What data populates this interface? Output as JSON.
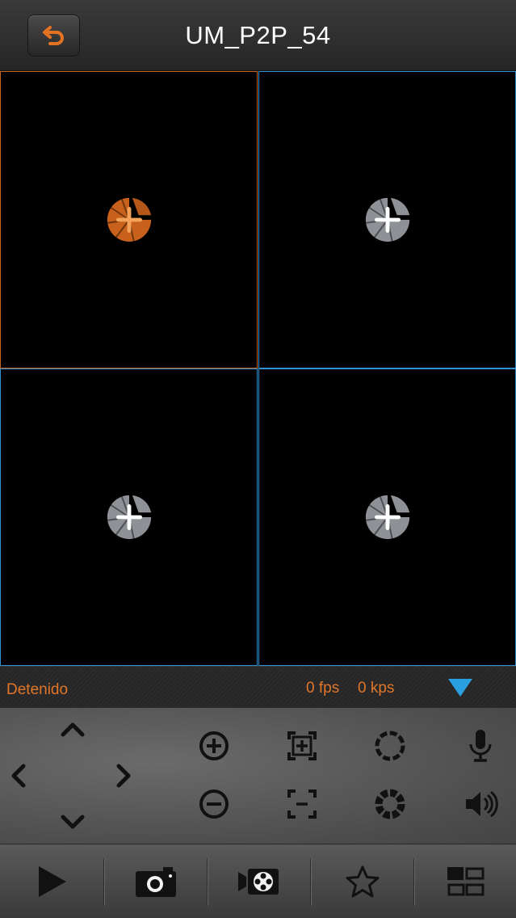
{
  "header": {
    "title": "UM_P2P_54",
    "back_icon": "back-arrow-icon",
    "accent_color": "#e37322"
  },
  "grid": {
    "cells": [
      {
        "id": "channel-1",
        "active": true,
        "icon": "add-camera-icon"
      },
      {
        "id": "channel-2",
        "active": false,
        "icon": "add-camera-icon"
      },
      {
        "id": "channel-3",
        "active": false,
        "icon": "add-camera-icon"
      },
      {
        "id": "channel-4",
        "active": false,
        "icon": "add-camera-icon"
      }
    ],
    "active_border_color": "#c5621d",
    "border_color": "#2c8fd1"
  },
  "status": {
    "state": "Detenido",
    "fps": "0 fps",
    "kps": "0 kps",
    "toggle_icon": "triangle-down-icon",
    "text_color": "#e0762a",
    "toggle_color": "#2aa0e0"
  },
  "controls": {
    "ptz": [
      "arrow-up-icon",
      "arrow-down-icon",
      "arrow-left-icon",
      "arrow-right-icon"
    ],
    "buttons": [
      "zoom-in-icon",
      "zoom-out-icon",
      "focus-in-icon",
      "focus-out-icon",
      "iris-open-icon",
      "iris-close-icon",
      "microphone-icon",
      "speaker-icon"
    ]
  },
  "toolbar": {
    "items": [
      "play-icon",
      "snapshot-icon",
      "record-icon",
      "favorite-icon",
      "layout-icon"
    ]
  }
}
